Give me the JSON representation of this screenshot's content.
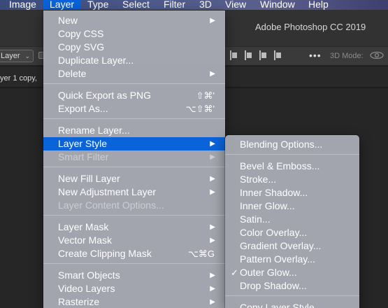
{
  "menubar": {
    "items": [
      {
        "label": "Image"
      },
      {
        "label": "Layer"
      },
      {
        "label": "Type"
      },
      {
        "label": "Select"
      },
      {
        "label": "Filter"
      },
      {
        "label": "3D"
      },
      {
        "label": "View"
      },
      {
        "label": "Window"
      },
      {
        "label": "Help"
      }
    ]
  },
  "app": {
    "title": "Adobe Photoshop CC 2019",
    "layer_select": "Layer",
    "mode_3d": "3D Mode:",
    "doc_tab": "yer 1 copy,"
  },
  "layer_menu": {
    "items": [
      {
        "label": "New"
      },
      {
        "label": "Copy CSS"
      },
      {
        "label": "Copy SVG"
      },
      {
        "label": "Duplicate Layer..."
      },
      {
        "label": "Delete"
      },
      {
        "label": "Quick Export as PNG",
        "shortcut": "⇧⌘'"
      },
      {
        "label": "Export As...",
        "shortcut": "⌥⇧⌘'"
      },
      {
        "label": "Rename Layer..."
      },
      {
        "label": "Layer Style"
      },
      {
        "label": "Smart Filter"
      },
      {
        "label": "New Fill Layer"
      },
      {
        "label": "New Adjustment Layer"
      },
      {
        "label": "Layer Content Options..."
      },
      {
        "label": "Layer Mask"
      },
      {
        "label": "Vector Mask"
      },
      {
        "label": "Create Clipping Mask",
        "shortcut": "⌥⌘G"
      },
      {
        "label": "Smart Objects"
      },
      {
        "label": "Video Layers"
      },
      {
        "label": "Rasterize"
      }
    ]
  },
  "style_menu": {
    "items": [
      {
        "label": "Blending Options..."
      },
      {
        "label": "Bevel & Emboss..."
      },
      {
        "label": "Stroke..."
      },
      {
        "label": "Inner Shadow..."
      },
      {
        "label": "Inner Glow..."
      },
      {
        "label": "Satin..."
      },
      {
        "label": "Color Overlay..."
      },
      {
        "label": "Gradient Overlay..."
      },
      {
        "label": "Pattern Overlay..."
      },
      {
        "label": "Outer Glow...",
        "checked": "✓"
      },
      {
        "label": "Drop Shadow..."
      },
      {
        "label": "Copy Layer Style"
      }
    ]
  },
  "colors": {
    "highlight": "#0a63d8",
    "menu_bg": "#acb0b8"
  }
}
